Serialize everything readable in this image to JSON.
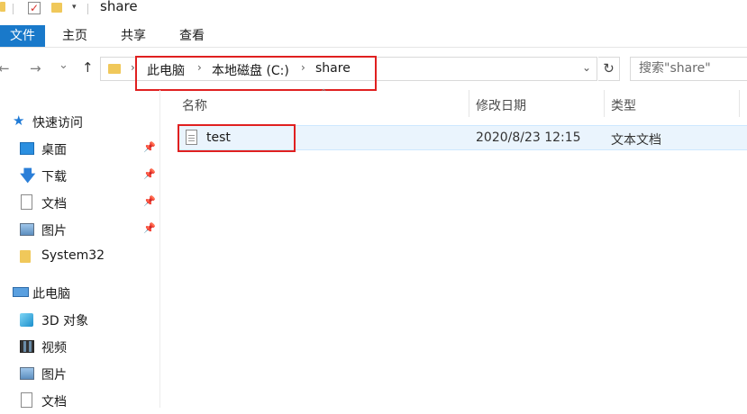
{
  "window": {
    "title": "share"
  },
  "quick_toolbar": {
    "icons": [
      "folder-icon",
      "properties-icon",
      "new-folder-icon",
      "customize-dropdown-icon"
    ]
  },
  "ribbon": {
    "tabs": [
      {
        "label": "文件",
        "active": true
      },
      {
        "label": "主页"
      },
      {
        "label": "共享"
      },
      {
        "label": "查看"
      }
    ],
    "accent": "#1979ca"
  },
  "navigation": {
    "back": "←",
    "forward": "→",
    "recent": "⌄",
    "up": "↑"
  },
  "address": {
    "crumbs": [
      "此电脑",
      "本地磁盘 (C:)",
      "share"
    ],
    "separator": "›"
  },
  "search": {
    "placeholder": "搜索\"share\""
  },
  "sidebar": {
    "quick_access": {
      "label": "快速访问"
    },
    "pinned": [
      {
        "label": "桌面",
        "icon": "desktop-icon",
        "pinned": true
      },
      {
        "label": "下载",
        "icon": "download-icon",
        "pinned": true
      },
      {
        "label": "文档",
        "icon": "documents-icon",
        "pinned": true
      },
      {
        "label": "图片",
        "icon": "pictures-icon",
        "pinned": true
      },
      {
        "label": "System32",
        "icon": "folder-icon",
        "pinned": false
      }
    ],
    "this_pc": {
      "label": "此电脑"
    },
    "pc_items": [
      {
        "label": "3D 对象",
        "icon": "3d-objects-icon"
      },
      {
        "label": "视频",
        "icon": "videos-icon"
      },
      {
        "label": "图片",
        "icon": "pictures-icon"
      },
      {
        "label": "文档",
        "icon": "documents-icon"
      }
    ]
  },
  "columns": {
    "name": "名称",
    "modified": "修改日期",
    "type": "类型"
  },
  "files": [
    {
      "name": "test",
      "modified": "2020/8/23 12:15",
      "type": "文本文档",
      "icon": "text-file-icon"
    }
  ],
  "colors": {
    "highlight_box": "#e02020",
    "selection": "#eaf4fd",
    "folder": "#f0c85a"
  }
}
